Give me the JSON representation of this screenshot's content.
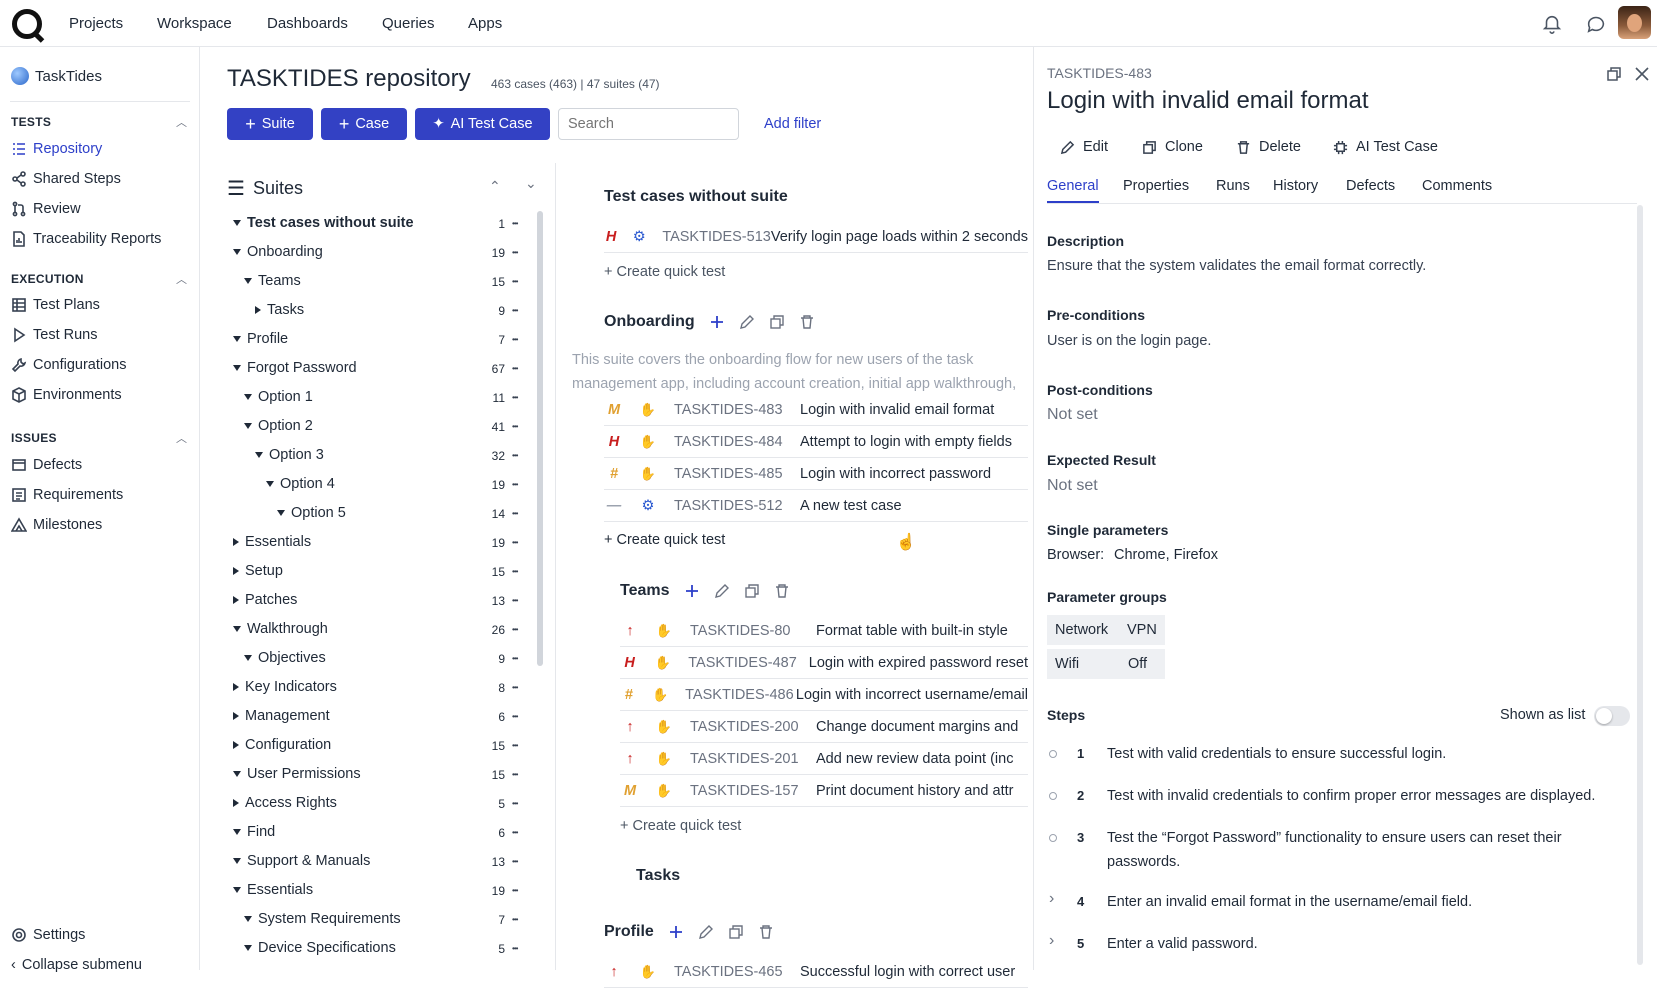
{
  "topnav": {
    "items": [
      "Projects",
      "Workspace",
      "Dashboards",
      "Queries",
      "Apps"
    ]
  },
  "sidebar": {
    "project": "TaskTides",
    "sections": [
      {
        "title": "TESTS",
        "items": [
          "Repository",
          "Shared Steps",
          "Review",
          "Traceability Reports"
        ]
      },
      {
        "title": "EXECUTION",
        "items": [
          "Test Plans",
          "Test Runs",
          "Configurations",
          "Environments"
        ]
      },
      {
        "title": "ISSUES",
        "items": [
          "Defects",
          "Requirements",
          "Milestones"
        ]
      }
    ],
    "settings": "Settings",
    "collapse": "Collapse submenu"
  },
  "repo": {
    "title": "TASKTIDES repository",
    "subtitle": "463 cases (463) | 47 suites (47)",
    "btn_suite": "Suite",
    "btn_case": "Case",
    "btn_ai": "AI Test Case",
    "search_placeholder": "Search",
    "add_filter": "Add filter",
    "suites_label": "Suites"
  },
  "tree": [
    {
      "label": "Test cases without suite",
      "count": "1",
      "level": 0,
      "open": true,
      "bold": true
    },
    {
      "label": "Onboarding",
      "count": "19",
      "level": 0,
      "open": true
    },
    {
      "label": "Teams",
      "count": "15",
      "level": 1,
      "open": true
    },
    {
      "label": "Tasks",
      "count": "9",
      "level": 2,
      "open": false
    },
    {
      "label": "Profile",
      "count": "7",
      "level": 0,
      "open": true
    },
    {
      "label": "Forgot Password",
      "count": "67",
      "level": 0,
      "open": true
    },
    {
      "label": "Option 1",
      "count": "11",
      "level": 1,
      "open": true
    },
    {
      "label": "Option 2",
      "count": "41",
      "level": 1,
      "open": true
    },
    {
      "label": "Option 3",
      "count": "32",
      "level": 2,
      "open": true
    },
    {
      "label": "Option 4",
      "count": "19",
      "level": 3,
      "open": true
    },
    {
      "label": "Option 5",
      "count": "14",
      "level": 4,
      "open": true
    },
    {
      "label": "Essentials",
      "count": "19",
      "level": 0,
      "open": false
    },
    {
      "label": "Setup",
      "count": "15",
      "level": 0,
      "open": false
    },
    {
      "label": "Patches",
      "count": "13",
      "level": 0,
      "open": false
    },
    {
      "label": "Walkthrough",
      "count": "26",
      "level": 0,
      "open": true
    },
    {
      "label": "Objectives",
      "count": "9",
      "level": 1,
      "open": true
    },
    {
      "label": "Key Indicators",
      "count": "8",
      "level": 0,
      "open": false
    },
    {
      "label": "Management",
      "count": "6",
      "level": 0,
      "open": false
    },
    {
      "label": "Configuration",
      "count": "15",
      "level": 0,
      "open": false
    },
    {
      "label": "User Permissions",
      "count": "15",
      "level": 0,
      "open": true
    },
    {
      "label": "Access Rights",
      "count": "5",
      "level": 0,
      "open": false
    },
    {
      "label": "Find",
      "count": "6",
      "level": 0,
      "open": true
    },
    {
      "label": "Support & Manuals",
      "count": "13",
      "level": 0,
      "open": true
    },
    {
      "label": "Essentials",
      "count": "19",
      "level": 0,
      "open": true
    },
    {
      "label": "System Requirements",
      "count": "7",
      "level": 1,
      "open": true
    },
    {
      "label": "Device Specifications",
      "count": "5",
      "level": 1,
      "open": true
    }
  ],
  "cases_panel": {
    "without_suite": {
      "title": "Test cases without suite",
      "rows": [
        {
          "pri": "H",
          "type": "auto",
          "key": "TASKTIDES-513",
          "title": "Verify login page loads within 2 seconds"
        }
      ],
      "quick": "+ Create quick test"
    },
    "onboarding": {
      "title": "Onboarding",
      "desc": "This suite covers the onboarding flow for new users of the task management app, including account creation, initial app walkthrough, permissions requests, and",
      "rows": [
        {
          "pri": "M",
          "type": "manual",
          "key": "TASKTIDES-483",
          "title": "Login with invalid email format"
        },
        {
          "pri": "H",
          "type": "manual",
          "key": "TASKTIDES-484",
          "title": "Attempt to login with empty fields"
        },
        {
          "pri": "#",
          "type": "manual",
          "key": "TASKTIDES-485",
          "title": "Login with incorrect password"
        },
        {
          "pri": "—",
          "type": "auto",
          "key": "TASKTIDES-512",
          "title": "A new test case"
        }
      ],
      "quick": "+ Create quick test"
    },
    "teams": {
      "title": "Teams",
      "rows": [
        {
          "pri": "↑",
          "type": "manual",
          "key": "TASKTIDES-80",
          "title": "Format table with built-in style"
        },
        {
          "pri": "H",
          "type": "manual",
          "key": "TASKTIDES-487",
          "title": "Login with expired password reset"
        },
        {
          "pri": "#",
          "type": "manual",
          "key": "TASKTIDES-486",
          "title": "Login with incorrect username/email"
        },
        {
          "pri": "↑",
          "type": "manual",
          "key": "TASKTIDES-200",
          "title": "Change document margins and"
        },
        {
          "pri": "↑",
          "type": "manual",
          "key": "TASKTIDES-201",
          "title": "Add new review data point (inc"
        },
        {
          "pri": "M",
          "type": "manual",
          "key": "TASKTIDES-157",
          "title": "Print document history and attr"
        }
      ],
      "quick": "+ Create quick test"
    },
    "tasks_title": "Tasks",
    "profile": {
      "title": "Profile",
      "rows": [
        {
          "pri": "↑",
          "type": "manual",
          "key": "TASKTIDES-465",
          "title": "Successful login with correct user"
        }
      ]
    }
  },
  "detail": {
    "key": "TASKTIDES-483",
    "title": "Login with invalid email format",
    "actions": [
      "Edit",
      "Clone",
      "Delete",
      "AI Test Case"
    ],
    "tabs": [
      "General",
      "Properties",
      "Runs",
      "History",
      "Defects",
      "Comments"
    ],
    "description_label": "Description",
    "description": "Ensure that the system validates the email format correctly.",
    "pre_label": "Pre-conditions",
    "pre": "User is on the login page.",
    "post_label": "Post-conditions",
    "post": "Not set",
    "expected_label": "Expected Result",
    "expected": "Not set",
    "single_label": "Single parameters",
    "single_key": "Browser:",
    "single_val": "Chrome, Firefox",
    "groups_label": "Parameter groups",
    "groups": [
      [
        "Network",
        "VPN"
      ],
      [
        "Wifi",
        "Off"
      ]
    ],
    "steps_label": "Steps",
    "shown_as_list": "Shown as list",
    "steps": [
      {
        "n": "1",
        "text": "Test with valid credentials to ensure successful login."
      },
      {
        "n": "2",
        "text": "Test with invalid credentials to confirm proper error messages are displayed."
      },
      {
        "n": "3",
        "text": "Test the “Forgot Password” functionality to ensure users can reset their passwords."
      },
      {
        "n": "4",
        "text": "Enter an invalid email format in the username/email field."
      },
      {
        "n": "5",
        "text": "Enter a valid password."
      }
    ]
  },
  "colors": {
    "accent": "#3341c4",
    "high": "#c81e1e",
    "medium": "#e0a030",
    "auto": "#2d5bd1"
  }
}
